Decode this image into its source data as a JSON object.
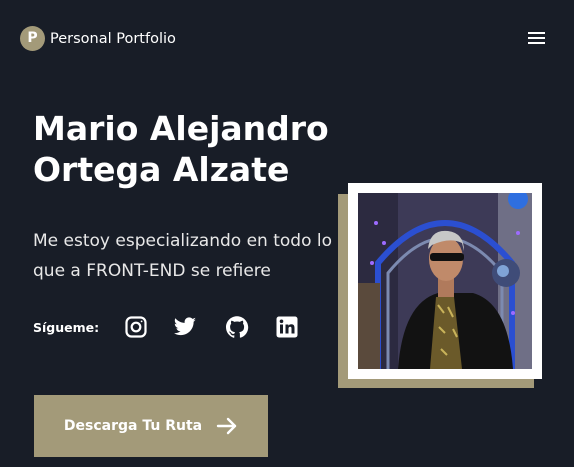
{
  "nav": {
    "brand_initial": "P",
    "brand_name": "Personal Portfolio",
    "menu_icon": "hamburger-menu-icon"
  },
  "hero": {
    "name": "Mario Alejandro Ortega Alzate",
    "tagline": "Me estoy especializando en todo lo que a FRONT-END se refiere",
    "social_label": "Sígueme:",
    "social_icons": [
      "instagram-icon",
      "twitter-icon",
      "github-icon",
      "linkedin-icon"
    ],
    "cta_label": "Descarga Tu Ruta",
    "cta_icon": "arrow-right-icon"
  },
  "colors": {
    "background": "#181d27",
    "accent": "#a39a79",
    "text": "#ffffff"
  }
}
